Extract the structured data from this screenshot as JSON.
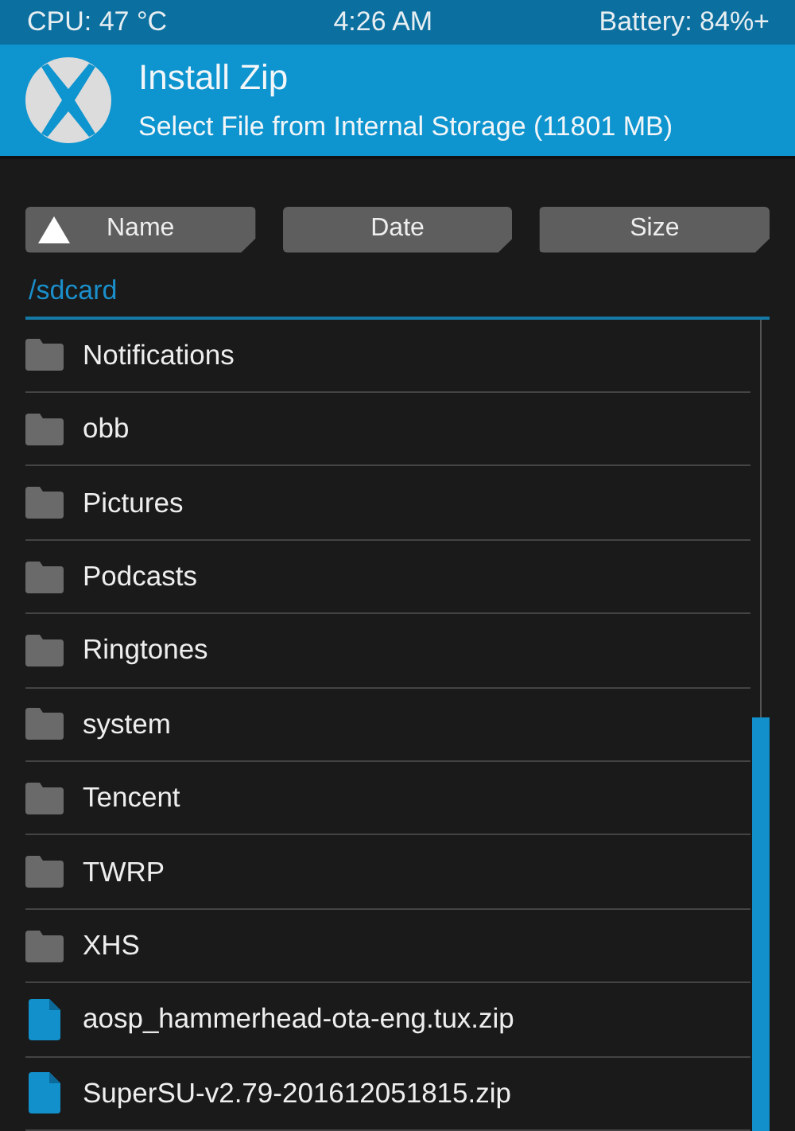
{
  "status_bar": {
    "cpu": "CPU: 47 °C",
    "time": "4:26 AM",
    "battery": "Battery: 84%+"
  },
  "header": {
    "title": "Install Zip",
    "subtitle": "Select File from Internal Storage (11801 MB)"
  },
  "sort_buttons": [
    {
      "label": "Name",
      "selected": true
    },
    {
      "label": "Date",
      "selected": false
    },
    {
      "label": "Size",
      "selected": false
    }
  ],
  "path": "/sdcard",
  "files": [
    {
      "name": "Notifications",
      "kind": "folder"
    },
    {
      "name": "obb",
      "kind": "folder"
    },
    {
      "name": "Pictures",
      "kind": "folder"
    },
    {
      "name": "Podcasts",
      "kind": "folder"
    },
    {
      "name": "Ringtones",
      "kind": "folder"
    },
    {
      "name": "system",
      "kind": "folder"
    },
    {
      "name": "Tencent",
      "kind": "folder"
    },
    {
      "name": "TWRP",
      "kind": "folder"
    },
    {
      "name": "XHS",
      "kind": "folder"
    },
    {
      "name": "aosp_hammerhead-ota-eng.tux.zip",
      "kind": "file"
    },
    {
      "name": "SuperSU-v2.79-201612051815.zip",
      "kind": "file"
    }
  ]
}
